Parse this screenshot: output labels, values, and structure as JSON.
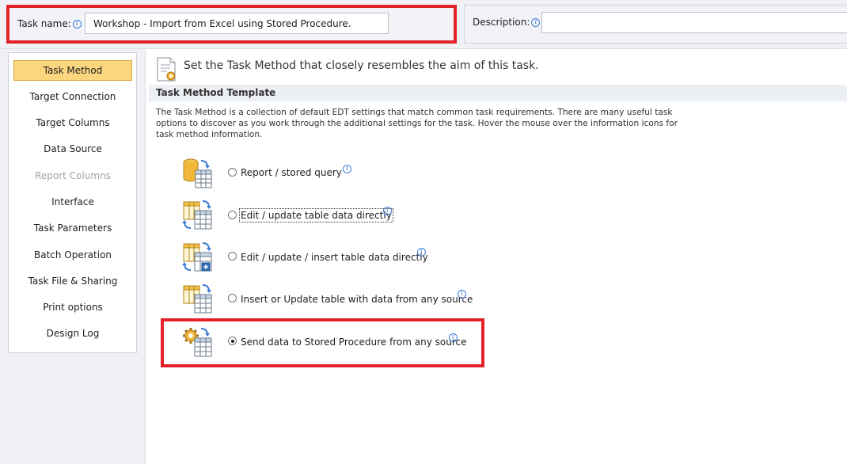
{
  "header": {
    "task_name_label": "Task name:",
    "task_name_value": "Workshop - Import from Excel using Stored Procedure.",
    "description_label": "Description:",
    "description_value": ""
  },
  "sidebar": {
    "items": [
      {
        "label": "Task Method",
        "state": "active"
      },
      {
        "label": "Target Connection",
        "state": "normal"
      },
      {
        "label": "Target Columns",
        "state": "normal"
      },
      {
        "label": "Data Source",
        "state": "normal"
      },
      {
        "label": "Report Columns",
        "state": "disabled"
      },
      {
        "label": "Interface",
        "state": "normal"
      },
      {
        "label": "Task Parameters",
        "state": "normal"
      },
      {
        "label": "Batch Operation",
        "state": "normal"
      },
      {
        "label": "Task File & Sharing",
        "state": "normal"
      },
      {
        "label": "Print options",
        "state": "normal"
      },
      {
        "label": "Design Log",
        "state": "normal"
      }
    ]
  },
  "main": {
    "heading": "Set the Task Method that closely resembles the aim of this task.",
    "section_title": "Task Method Template",
    "description": "The Task Method is a collection of default EDT settings that match common task requirements. There are many useful task options to discover as you work through the additional settings for the task. Hover the mouse over the information icons for task method information.",
    "options": [
      {
        "label": "Report / stored query",
        "icon": "database-table-icon",
        "checked": false
      },
      {
        "label": "Edit / update table data directly",
        "icon": "table-edit-icon",
        "checked": false
      },
      {
        "label": "Edit / update / insert table data directly",
        "icon": "table-insert-icon",
        "checked": false
      },
      {
        "label": "Insert or Update table with data from any source",
        "icon": "table-upsert-icon",
        "checked": false
      },
      {
        "label": "Send data to Stored Procedure from any source",
        "icon": "gear-table-icon",
        "checked": true
      }
    ]
  },
  "colors": {
    "highlight_red": "#e32129",
    "active_nav": "#fbd67f",
    "info_blue": "#3d7ed8"
  }
}
